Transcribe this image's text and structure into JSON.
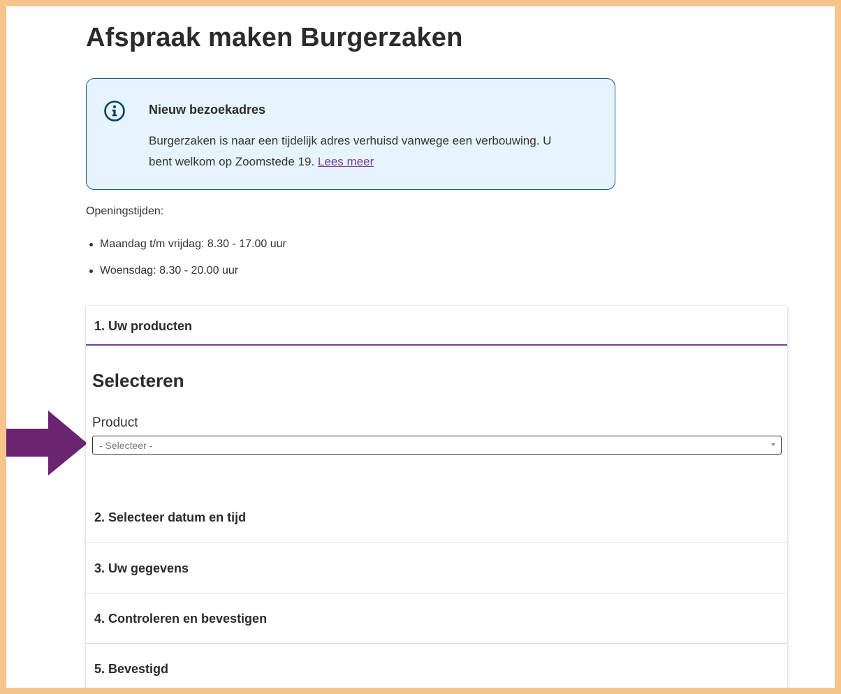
{
  "page": {
    "title": "Afspraak maken Burgerzaken"
  },
  "notice": {
    "icon": "info-icon",
    "title": "Nieuw bezoekadres",
    "body": "Burgerzaken is naar een tijdelijk adres verhuisd vanwege een verbouwing. U bent welkom op Zoomstede 19.",
    "link_label": "Lees meer",
    "colors": {
      "background": "#e6f5fd",
      "border": "#1e5a86",
      "link": "#7a3e98"
    }
  },
  "hours": {
    "label": "Openingstijden:",
    "items": [
      "Maandag t/m vrijdag: 8.30 - 17.00 uur",
      "Woensdag: 8.30 -  20.00 uur"
    ]
  },
  "steps": {
    "active": {
      "label": "1. Uw producten",
      "heading": "Selecteren",
      "field_label": "Product",
      "select_value": "- Selecteer -",
      "accent_color": "#7a3e98"
    },
    "remaining": [
      "2. Selecteer datum en tijd",
      "3. Uw gegevens",
      "4. Controleren en bevestigen",
      "5. Bevestigd"
    ]
  },
  "annotation": {
    "icon": "arrow-right-icon",
    "color": "#6b2472",
    "frame_color": "#f5c58c"
  }
}
